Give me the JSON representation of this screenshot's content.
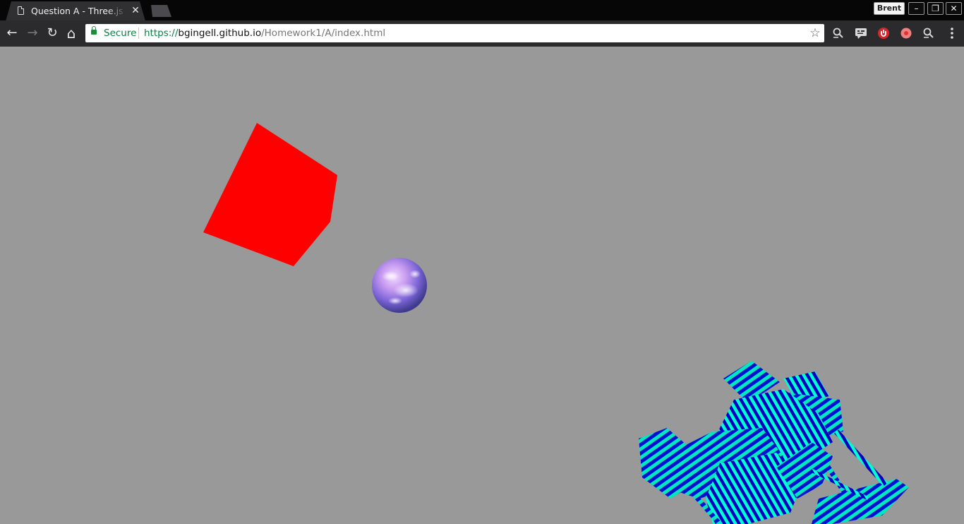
{
  "browser": {
    "tab": {
      "title": "Question A - Three.js scene",
      "close_glyph": "✕"
    },
    "profile_name": "Brent",
    "window_controls": {
      "minimize": "–",
      "restore": "❐",
      "close": "✕"
    },
    "nav": {
      "back": "←",
      "forward": "→",
      "reload": "↻",
      "home": "⌂"
    },
    "address_bar": {
      "security_label": "Secure",
      "url_scheme": "https://",
      "url_host": "bgingell.github.io",
      "url_path": "/Homework1/A/index.html",
      "bookmark_glyph": "☆"
    },
    "extensions": [
      "magnifier-icon",
      "chat-icon",
      "shield-icon",
      "record-icon",
      "magnifier-icon",
      "menu-icon"
    ]
  },
  "scene": {
    "background_color": "#999999",
    "objects": [
      {
        "name": "cube",
        "color": "#ff0000"
      },
      {
        "name": "sphere",
        "texture": "purple-cloud"
      },
      {
        "name": "striped-model",
        "stripe_colors": [
          "#00e8c0",
          "#0000cc",
          "#00ffd0"
        ]
      }
    ]
  }
}
